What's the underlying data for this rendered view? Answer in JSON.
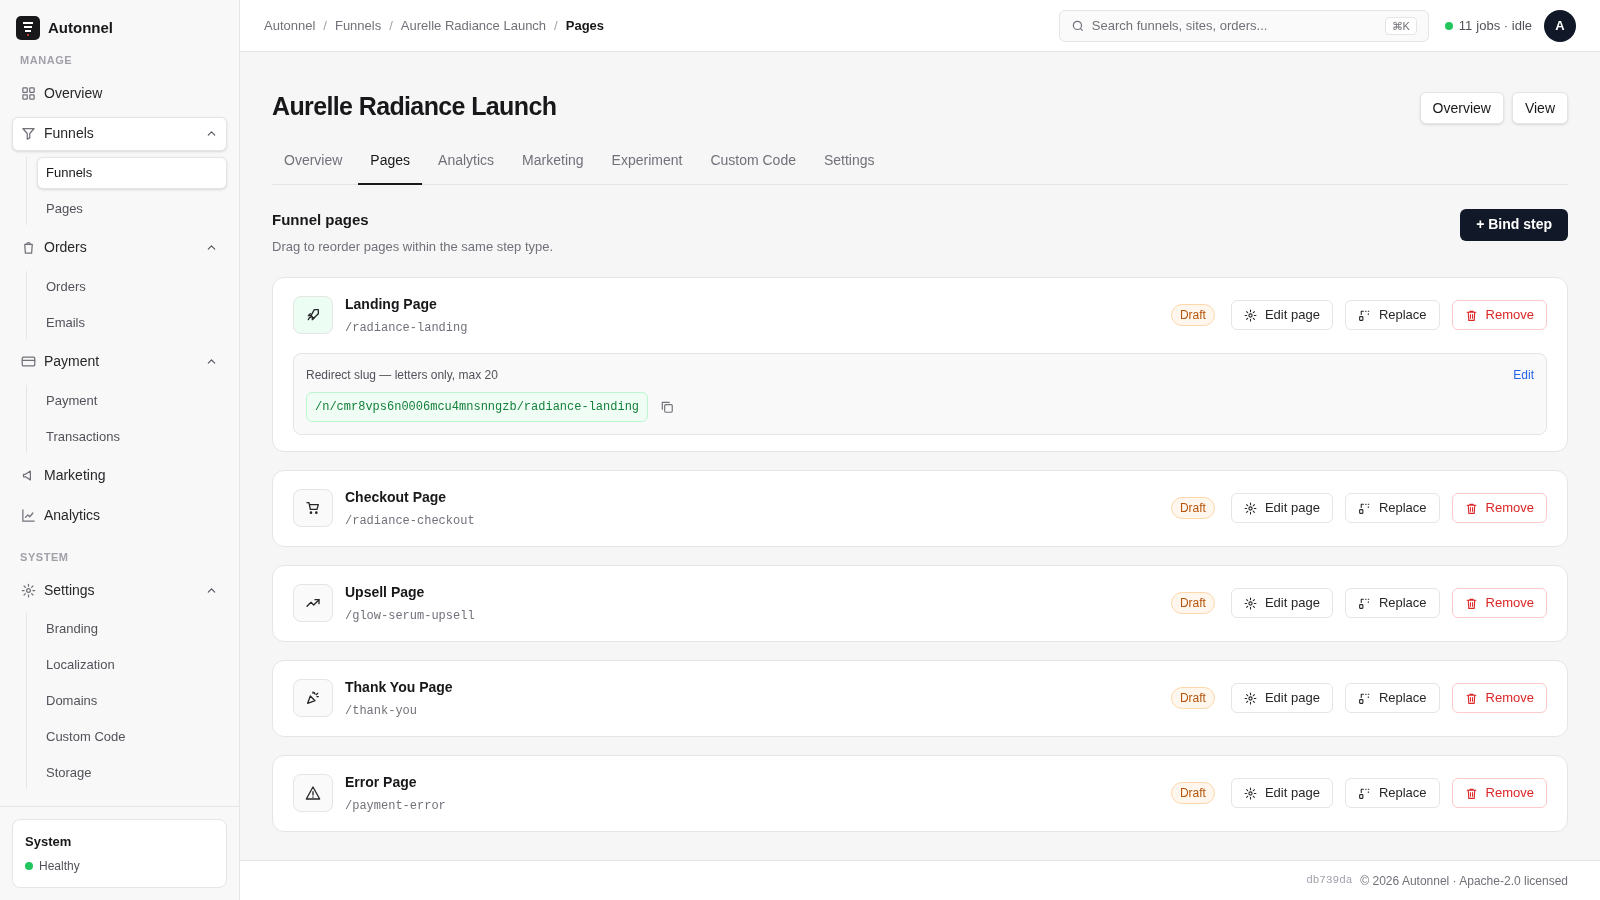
{
  "brand": {
    "name": "Autonnel"
  },
  "sidebar": {
    "sections": [
      {
        "heading": "MANAGE",
        "items": [
          {
            "label": "Overview",
            "selected": false
          },
          {
            "label": "Funnels",
            "selected": true,
            "expanded": true,
            "children": [
              {
                "label": "Funnels",
                "selected": true
              },
              {
                "label": "Pages",
                "selected": false
              }
            ]
          },
          {
            "label": "Orders",
            "selected": false,
            "expanded": true,
            "children": [
              {
                "label": "Orders",
                "selected": false
              },
              {
                "label": "Emails",
                "selected": false
              }
            ]
          },
          {
            "label": "Payment",
            "selected": false,
            "expanded": true,
            "children": [
              {
                "label": "Payment",
                "selected": false
              },
              {
                "label": "Transactions",
                "selected": false
              }
            ]
          },
          {
            "label": "Marketing",
            "selected": false
          },
          {
            "label": "Analytics",
            "selected": false
          }
        ]
      },
      {
        "heading": "SYSTEM",
        "items": [
          {
            "label": "Settings",
            "selected": false,
            "expanded": true,
            "children": [
              {
                "label": "Branding",
                "selected": false
              },
              {
                "label": "Localization",
                "selected": false
              },
              {
                "label": "Domains",
                "selected": false
              },
              {
                "label": "Custom Code",
                "selected": false
              },
              {
                "label": "Storage",
                "selected": false
              }
            ]
          }
        ]
      }
    ],
    "system_card": {
      "title": "System",
      "status": "Healthy",
      "color": "#22c55e"
    }
  },
  "breadcrumbs": {
    "separator": "/",
    "items": [
      "Autonnel",
      "Funnels",
      "Aurelle Radiance Launch",
      "Pages"
    ]
  },
  "search": {
    "placeholder": "Search funnels, sites, orders...",
    "shortcut": "⌘K"
  },
  "jobs": {
    "count": "11",
    "text": "jobs · idle",
    "color": "#22c55e"
  },
  "avatar": "A",
  "page": {
    "title": "Aurelle Radiance Launch",
    "actions": [
      "Overview",
      "View"
    ]
  },
  "tabs": [
    {
      "label": "Overview",
      "selected": false
    },
    {
      "label": "Pages",
      "selected": true
    },
    {
      "label": "Analytics",
      "selected": false
    },
    {
      "label": "Marketing",
      "selected": false
    },
    {
      "label": "Experiment",
      "selected": false
    },
    {
      "label": "Custom Code",
      "selected": false
    },
    {
      "label": "Settings",
      "selected": false
    }
  ],
  "section": {
    "title": "Funnel pages",
    "subtitle": "Drag to reorder pages within the same step type.",
    "button": "+ Bind step"
  },
  "pages": [
    {
      "title": "Landing Page",
      "slug": "/radiance-landing",
      "status": "Draft",
      "buttons": [
        "Edit page",
        "Replace",
        "Remove"
      ],
      "redirect": {
        "label": "Redirect slug — letters only, max 20",
        "link": "Edit",
        "value": "/n/cmr8vps6n0006mcu4mnsnngzb/radiance-landing"
      }
    },
    {
      "title": "Checkout Page",
      "slug": "/radiance-checkout",
      "status": "Draft",
      "buttons": [
        "Edit page",
        "Replace",
        "Remove"
      ]
    },
    {
      "title": "Upsell Page",
      "slug": "/glow-serum-upsell",
      "status": "Draft",
      "buttons": [
        "Edit page",
        "Replace",
        "Remove"
      ]
    },
    {
      "title": "Thank You Page",
      "slug": "/thank-you",
      "status": "Draft",
      "buttons": [
        "Edit page",
        "Replace",
        "Remove"
      ]
    },
    {
      "title": "Error Page",
      "slug": "/payment-error",
      "status": "Draft",
      "buttons": [
        "Edit page",
        "Replace",
        "Remove"
      ]
    }
  ],
  "footer": {
    "commit": "db739da",
    "text": "© 2026 Autonnel · Apache-2.0 licensed"
  }
}
